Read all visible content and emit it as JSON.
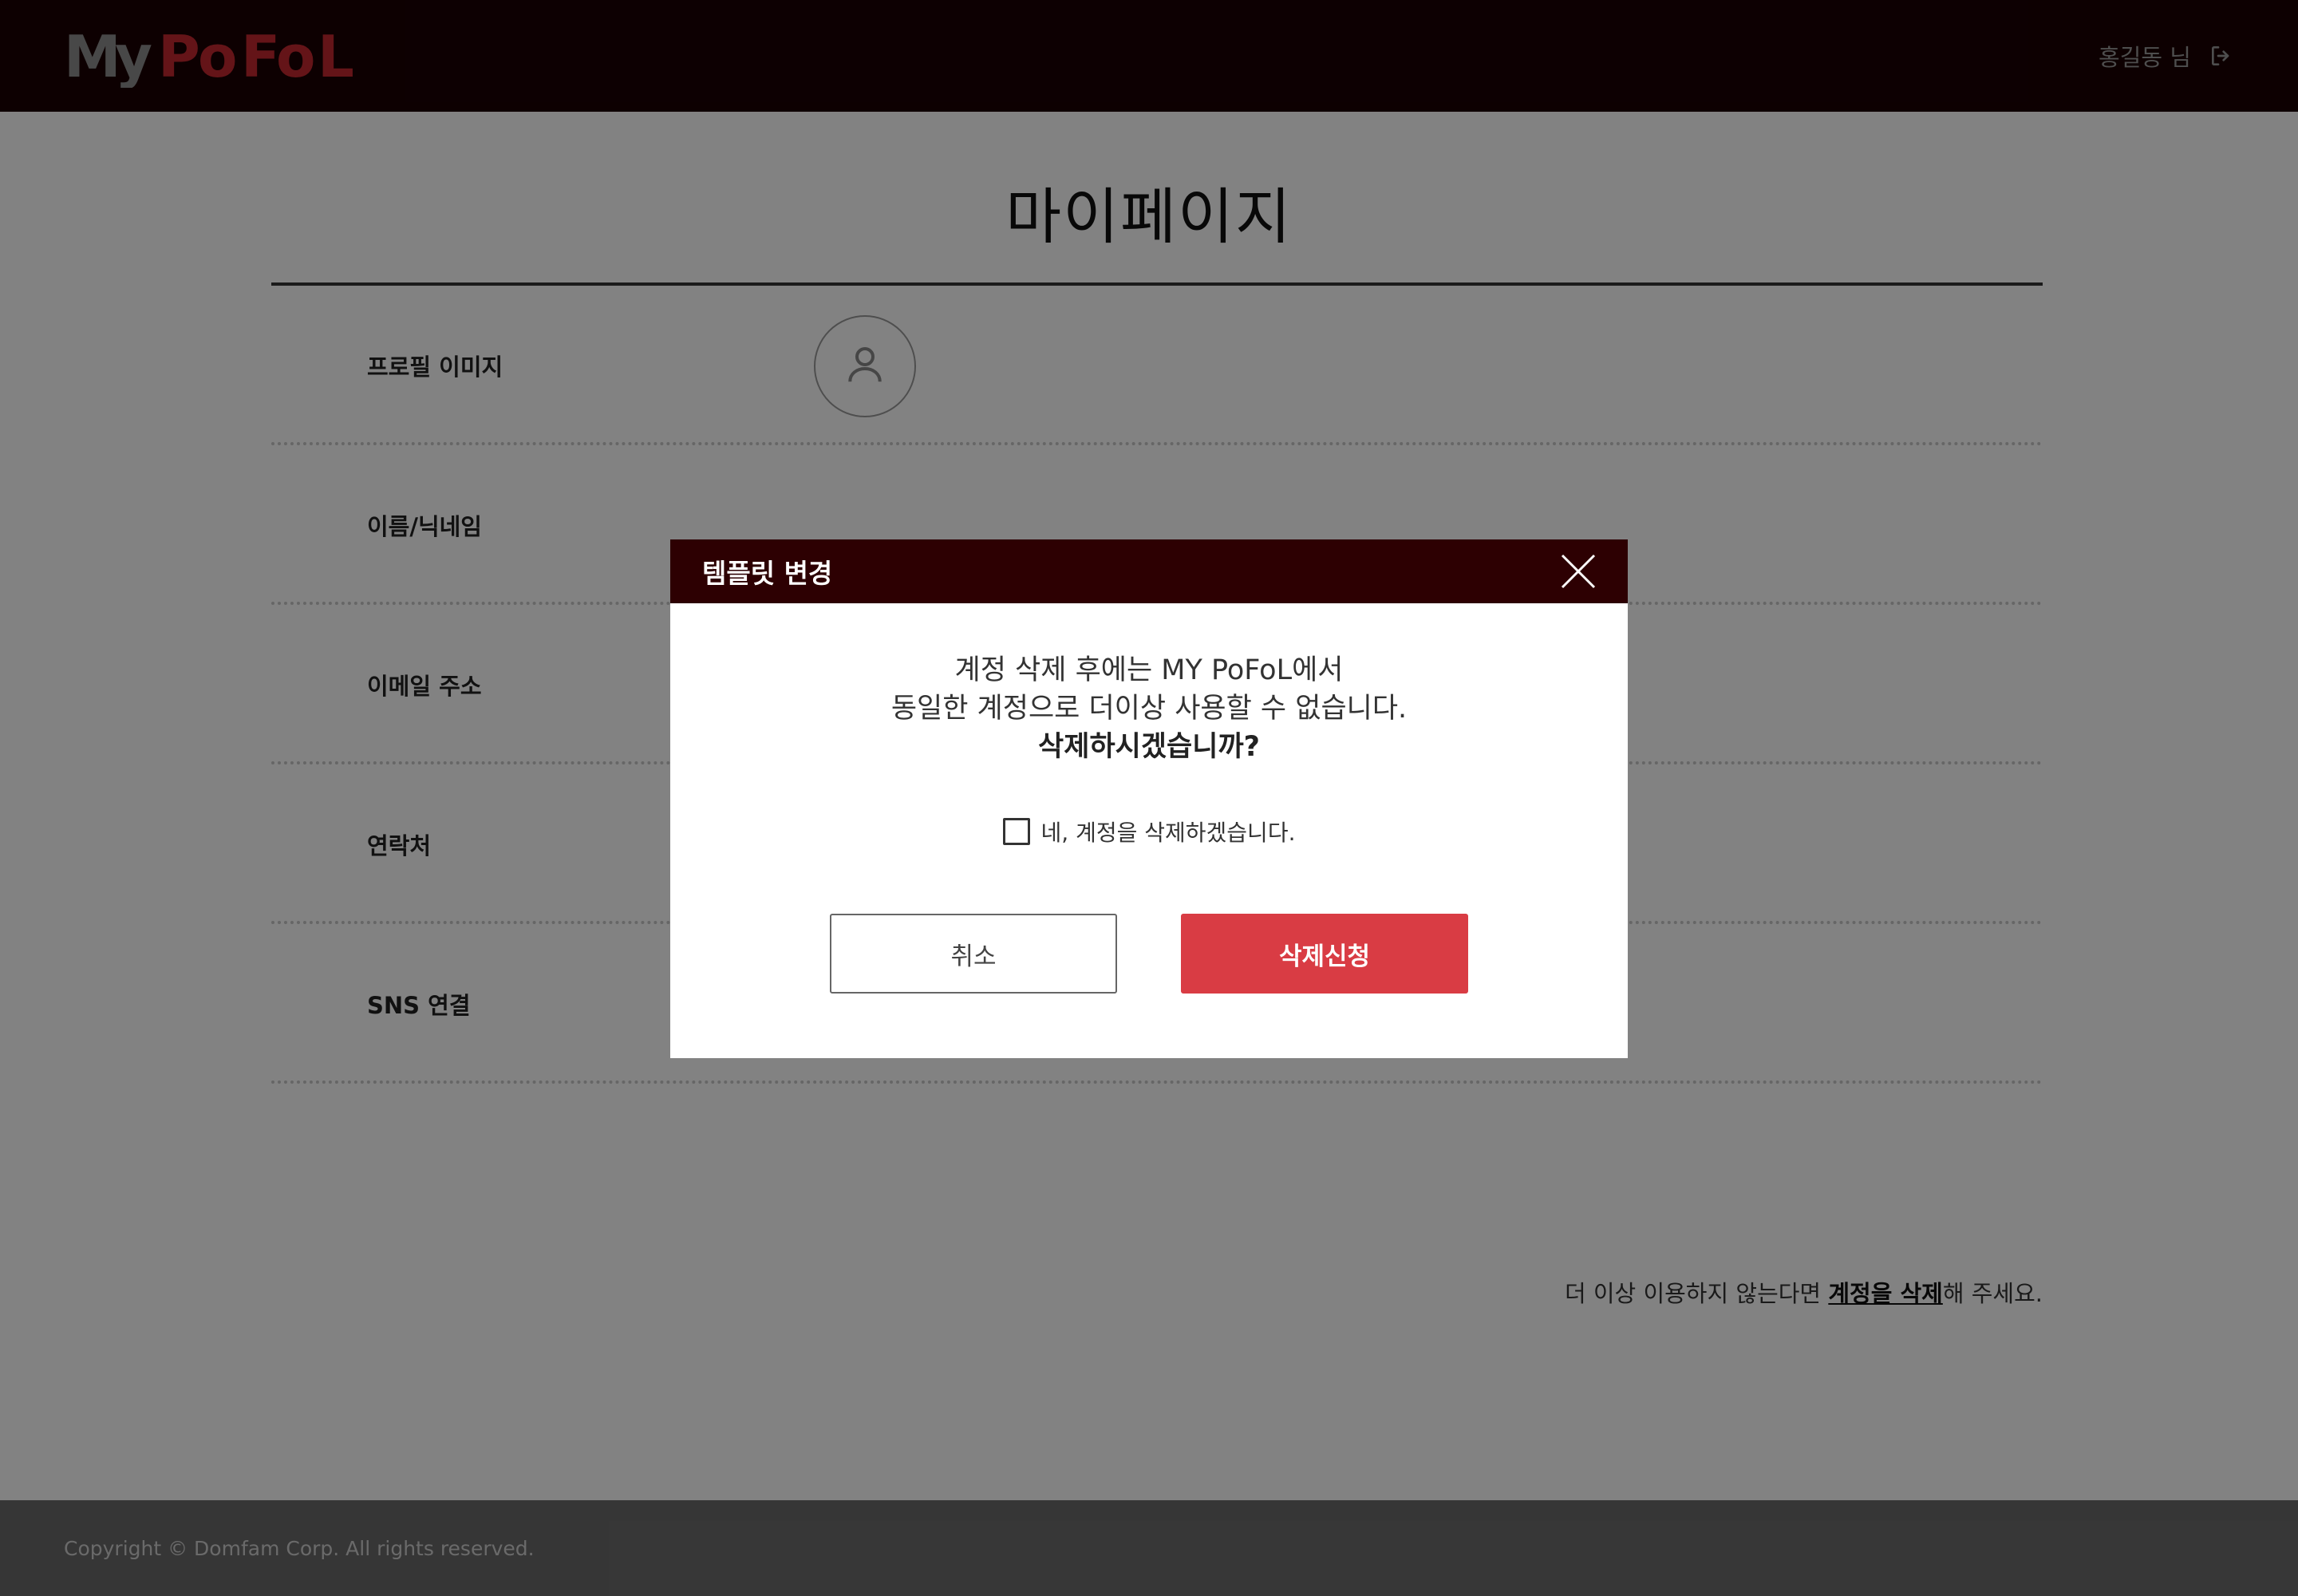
{
  "header": {
    "logo_text": "MyPoFoL",
    "user_name": "홍길동 님",
    "logout_icon": "logout-icon"
  },
  "page": {
    "title": "마이페이지",
    "rows": [
      {
        "label": "프로필 이미지"
      },
      {
        "label": "이름/닉네임"
      },
      {
        "label": "이메일 주소"
      },
      {
        "label": "연락처"
      },
      {
        "label": "SNS 연결"
      }
    ],
    "delete_hint": {
      "prefix": "더 이상 이용하지 않는다면 ",
      "link": "계정을 삭제",
      "suffix": "해 주세요."
    }
  },
  "footer": {
    "copyright": "Copyright © Domfam Corp. All rights reserved."
  },
  "modal": {
    "title": "템플릿 변경",
    "message_line1": "계정 삭제 후에는 MY PoFoL에서",
    "message_line2": "동일한 계정으로 더이상 사용할 수 없습니다.",
    "message_line3": "삭제하시겠습니까?",
    "checkbox_label": "네, 계정을 삭제하겠습니다.",
    "checkbox_checked": false,
    "cancel_label": "취소",
    "confirm_label": "삭제신청"
  },
  "colors": {
    "header_bg": "#1a0003",
    "modal_header_bg": "#2d0002",
    "accent_red": "#d93c44"
  }
}
